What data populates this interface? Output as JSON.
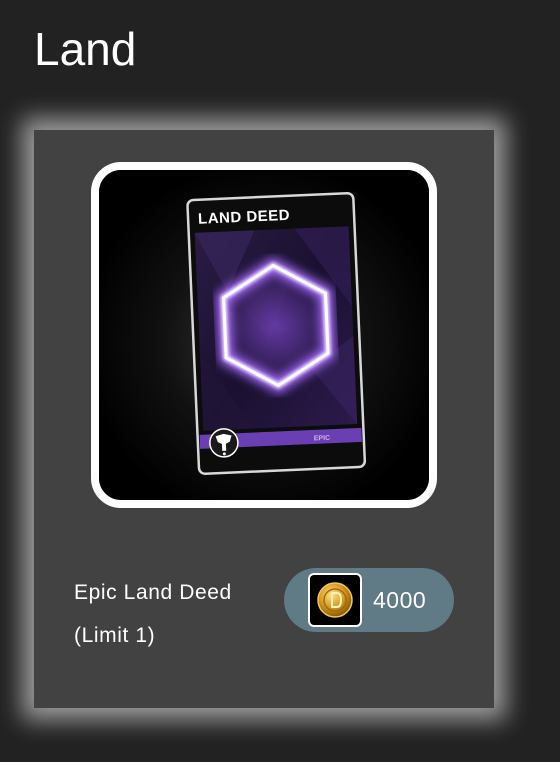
{
  "page": {
    "title": "Land"
  },
  "item": {
    "name": "Epic Land Deed\n(Limit 1)",
    "card_title": "LAND DEED",
    "rarity": "EPIC",
    "price": "4000",
    "price_icon": "gold-coin-icon",
    "rarity_color": "#6a3fb4",
    "accent_color": "#c48cff"
  }
}
